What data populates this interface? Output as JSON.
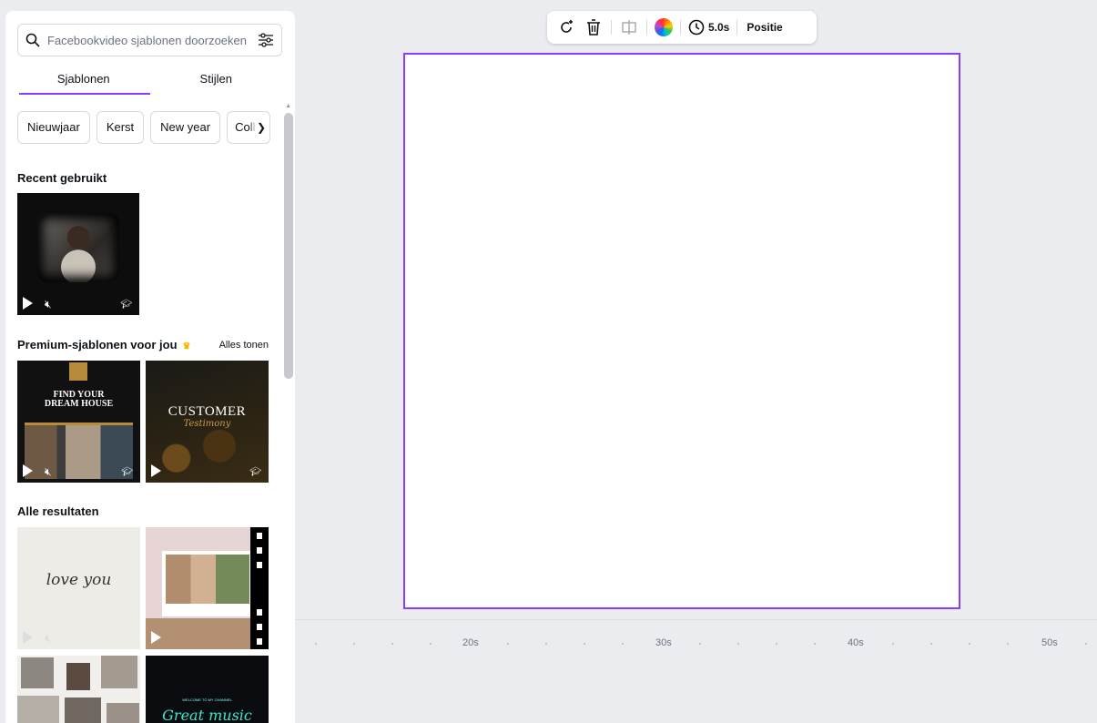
{
  "search": {
    "placeholder": "Facebookvideo sjablonen doorzoeken"
  },
  "tabs": [
    {
      "label": "Sjablonen"
    },
    {
      "label": "Stijlen"
    }
  ],
  "chips": [
    "Nieuwjaar",
    "Kerst",
    "New year",
    "Colle"
  ],
  "sections": {
    "recent": "Recent gebruikt",
    "premium": "Premium-sjablonen voor jou",
    "see_all": "Alles tonen",
    "all_results": "Alle resultaten"
  },
  "templates": {
    "house": {
      "line1": "FIND YOUR",
      "line2": "DREAM HOUSE"
    },
    "customer": {
      "title": "CUSTOMER",
      "sub": "Testimony"
    },
    "love": {
      "text": "love you"
    },
    "music": {
      "small": "WELCOME TO MY CHANNEL",
      "text": "Great music"
    }
  },
  "toolbar": {
    "duration": "5.0s",
    "position_label": "Positie"
  },
  "timeline": {
    "labels": [
      "20s",
      "30s",
      "40s",
      "50s"
    ]
  },
  "colors": {
    "accent": "#8b3dff",
    "canvas_bg": "#ebecf0"
  },
  "icons": [
    "search-icon",
    "filter-icon",
    "regenerate-icon",
    "trash-icon",
    "split-icon",
    "color-icon",
    "clock-icon",
    "play-icon",
    "mute-icon",
    "graduation-cap-icon",
    "crown-icon"
  ]
}
